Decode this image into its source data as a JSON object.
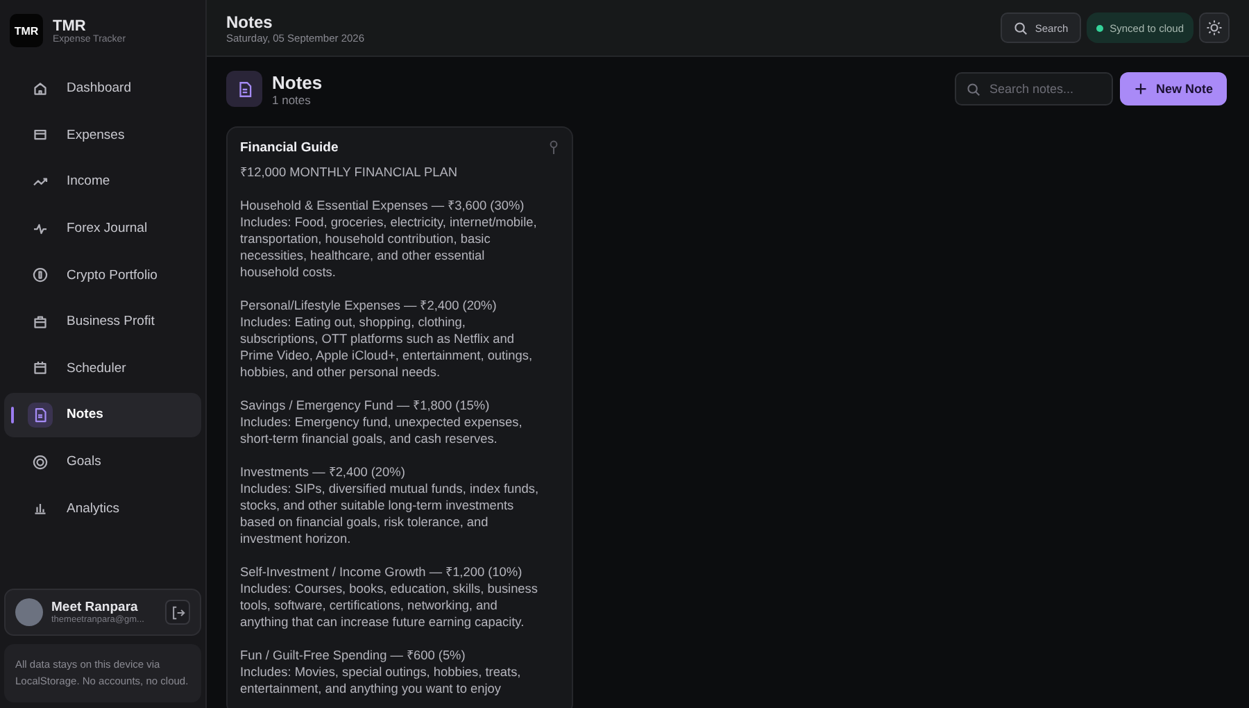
{
  "brand": {
    "logo_text": "TMR",
    "name": "TMR",
    "subtitle": "Expense Tracker"
  },
  "nav": [
    {
      "label": "Dashboard",
      "selected": false
    },
    {
      "label": "Expenses",
      "selected": false
    },
    {
      "label": "Income",
      "selected": false
    },
    {
      "label": "Forex Journal",
      "selected": false
    },
    {
      "label": "Crypto Portfolio",
      "selected": false
    },
    {
      "label": "Business Profit",
      "selected": false
    },
    {
      "label": "Scheduler",
      "selected": false
    },
    {
      "label": "Notes",
      "selected": true
    },
    {
      "label": "Goals",
      "selected": false
    },
    {
      "label": "Analytics",
      "selected": false
    }
  ],
  "user": {
    "name": "Meet Ranpara",
    "email": "themeetranpara@gm..."
  },
  "storage_note": "All data stays on this device via LocalStorage. No accounts, no cloud.",
  "header": {
    "title": "Notes",
    "date": "Saturday, 05 September 2026",
    "search_label": "Search",
    "sync_label": "Synced to cloud",
    "synced": true
  },
  "page": {
    "title": "Notes",
    "count": "1 notes",
    "search": {
      "placeholder": "Search notes..."
    },
    "new_button": "New Note"
  },
  "notes": [
    {
      "title": "Financial Guide",
      "pinned": false,
      "paragraphs": [
        "₹12,000 MONTHLY FINANCIAL PLAN",
        "Household & Essential Expenses — ₹3,600 (30%)\nIncludes: Food, groceries, electricity, internet/mobile,\ntransportation, household contribution, basic\nnecessities, healthcare, and other essential\nhousehold costs.",
        "Personal/Lifestyle Expenses — ₹2,400 (20%)\nIncludes: Eating out, shopping, clothing,\nsubscriptions, OTT platforms such as Netflix and\nPrime Video, Apple iCloud+, entertainment, outings,\nhobbies, and other personal needs.",
        "Savings / Emergency Fund — ₹1,800 (15%)\nIncludes: Emergency fund, unexpected expenses,\nshort-term financial goals, and cash reserves.",
        "Investments — ₹2,400 (20%)\nIncludes: SIPs, diversified mutual funds, index funds,\nstocks, and other suitable long-term investments\nbased on financial goals, risk tolerance, and\ninvestment horizon.",
        "Self-Investment / Income Growth — ₹1,200 (10%)\nIncludes: Courses, books, education, skills, business\ntools, software, certifications, networking, and\nanything that can increase future earning capacity.",
        "Fun / Guilt-Free Spending — ₹600 (5%)\nIncludes: Movies, special outings, hobbies, treats,\nentertainment, and anything you want to enjoy"
      ]
    }
  ]
}
